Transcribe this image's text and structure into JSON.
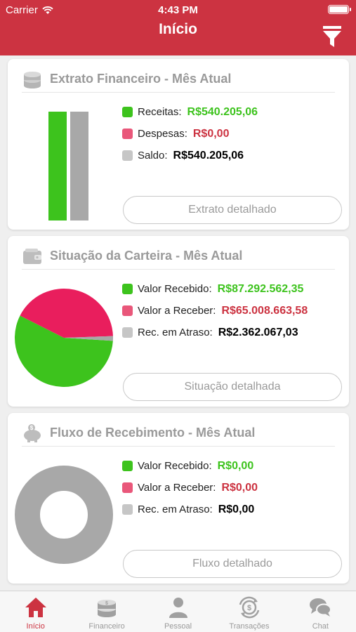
{
  "colors": {
    "header": "#cc3341",
    "green": "#3dc31d",
    "red": "#cc3341",
    "pink": "#e91e5d",
    "gray": "#a8a8a8",
    "muted": "#9a9a9a",
    "tab_active": "#cc3341"
  },
  "status_bar": {
    "carrier": "Carrier",
    "time": "4:43 PM"
  },
  "header": {
    "title": "Início",
    "filter_icon": "filter-funnel-icon"
  },
  "card_extrato": {
    "title": "Extrato Financeiro - Mês Atual",
    "icon": "coins-stack-icon",
    "legend": [
      {
        "label": "Receitas:",
        "value": "R$540.205,06",
        "swatch": "#3dc31d",
        "value_color": "#3dc31d"
      },
      {
        "label": "Despesas:",
        "value": "R$0,00",
        "swatch": "#e9577a",
        "value_color": "#cc3341"
      },
      {
        "label": "Saldo:",
        "value": "R$540.205,06",
        "swatch": "#c6c6c6",
        "value_color": "#000000"
      }
    ],
    "button": "Extrato detalhado",
    "bars": {
      "values": [
        540205.06,
        540205.06
      ],
      "colors": [
        "#3dc31d",
        "#a8a8a8"
      ]
    }
  },
  "card_carteira": {
    "title": "Situação da Carteira - Mês Atual",
    "icon": "wallet-icon",
    "legend": [
      {
        "label": "Valor Recebido:",
        "value": "R$87.292.562,35",
        "swatch": "#3dc31d",
        "value_color": "#3dc31d"
      },
      {
        "label": "Valor a Receber:",
        "value": "R$65.008.663,58",
        "swatch": "#e9577a",
        "value_color": "#cc3341"
      },
      {
        "label": "Rec. em Atraso:",
        "value": "R$2.362.067,03",
        "swatch": "#c6c6c6",
        "value_color": "#000000"
      }
    ],
    "button": "Situação detalhada"
  },
  "card_fluxo": {
    "title": "Fluxo de Recebimento - Mês Atual",
    "icon": "piggy-bank-icon",
    "legend": [
      {
        "label": "Valor Recebido:",
        "value": "R$0,00",
        "swatch": "#3dc31d",
        "value_color": "#3dc31d"
      },
      {
        "label": "Valor a Receber:",
        "value": "R$0,00",
        "swatch": "#e9577a",
        "value_color": "#cc3341"
      },
      {
        "label": "Rec. em Atraso:",
        "value": "R$0,00",
        "swatch": "#c6c6c6",
        "value_color": "#000000"
      }
    ],
    "button": "Fluxo detalhado"
  },
  "chart_data": [
    {
      "type": "bar",
      "categories": [
        "Receitas",
        "Saldo"
      ],
      "values": [
        540205.06,
        540205.06
      ],
      "title": "",
      "xlabel": "",
      "ylabel": ""
    },
    {
      "type": "pie",
      "labels": [
        "Valor Recebido",
        "Valor a Receber",
        "Rec. em Atraso"
      ],
      "values": [
        87292562.35,
        65008663.58,
        2362067.03
      ],
      "colors": [
        "#3dc31d",
        "#e91e5d",
        "#a8a8a8"
      ]
    },
    {
      "type": "pie",
      "labels": [
        "Valor Recebido",
        "Valor a Receber",
        "Rec. em Atraso"
      ],
      "values": [
        0,
        0,
        0
      ],
      "colors": [
        "#3dc31d",
        "#e91e5d",
        "#a8a8a8"
      ],
      "style": "donut-empty"
    }
  ],
  "tabbar": {
    "tabs": [
      {
        "label": "Início",
        "icon": "home-icon",
        "active": true
      },
      {
        "label": "Financeiro",
        "icon": "coins-icon",
        "active": false
      },
      {
        "label": "Pessoal",
        "icon": "person-icon",
        "active": false
      },
      {
        "label": "Transações",
        "icon": "transactions-icon",
        "active": false
      },
      {
        "label": "Chat",
        "icon": "chat-bubbles-icon",
        "active": false
      }
    ]
  }
}
